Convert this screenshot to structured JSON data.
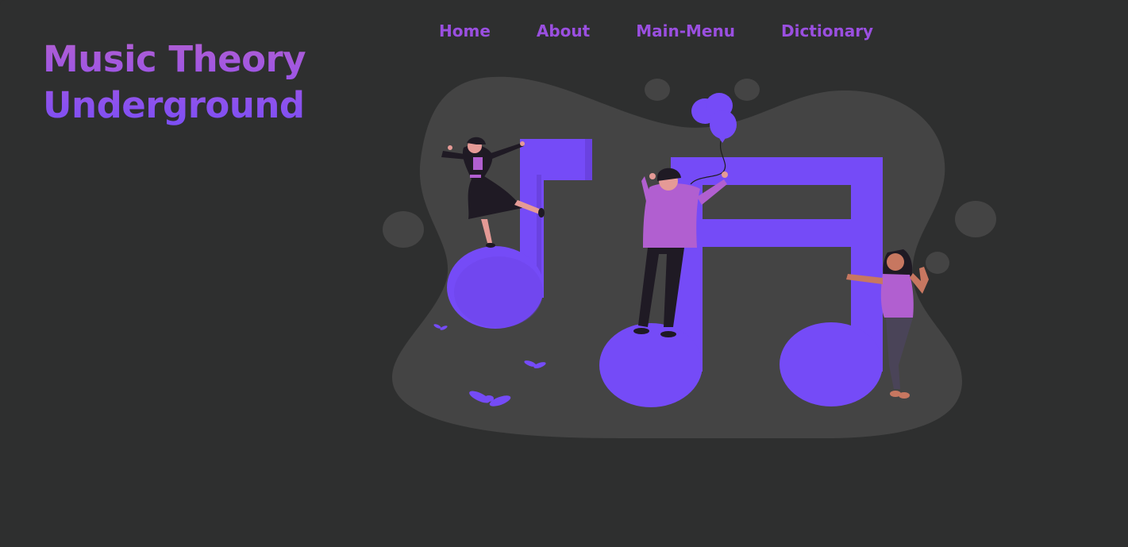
{
  "brand": {
    "line1": "Music Theory",
    "line2": "Underground"
  },
  "nav": {
    "home": "Home",
    "about": "About",
    "main_menu": "Main-Menu",
    "dictionary": "Dictionary"
  },
  "hero": {
    "illustration": "music-notes-dancers-illustration"
  },
  "colors": {
    "background": "#2e2f2f",
    "blob": "#444444",
    "accent_purple": "#754bf7",
    "nav_text": "#9a4fe0",
    "figure_pink": "#b15fd0"
  }
}
